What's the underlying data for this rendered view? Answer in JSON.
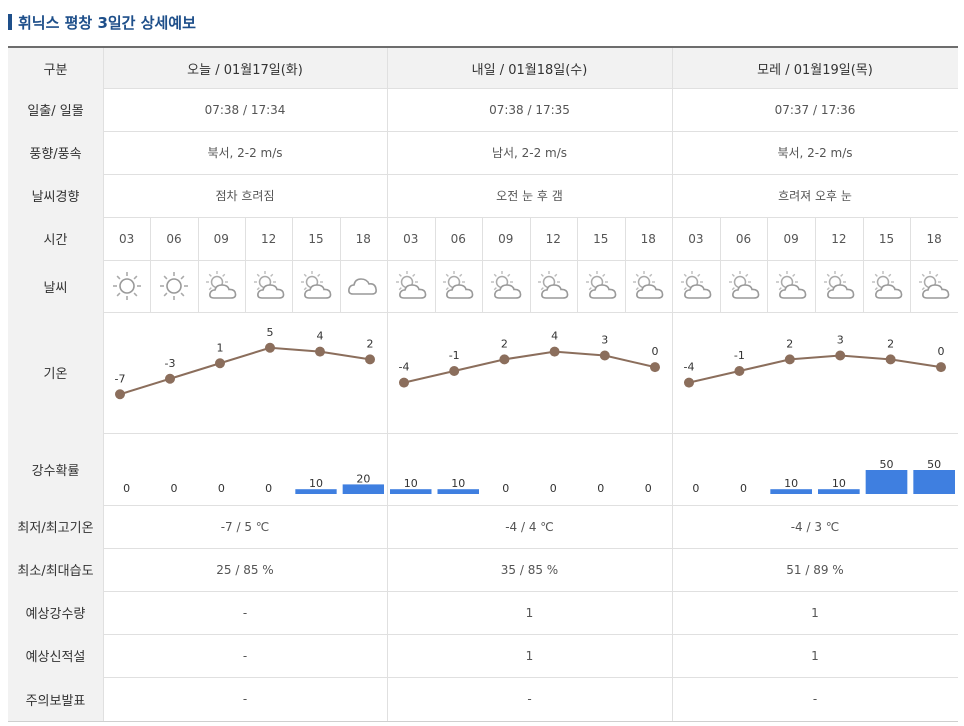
{
  "title": "휘닉스 평창 3일간 상세예보",
  "header": {
    "label": "구분",
    "days": [
      "오늘 / 01월17일(화)",
      "내일 / 01월18일(수)",
      "모레 / 01월19일(목)"
    ]
  },
  "rows": {
    "sun": {
      "label": "일출/ 일몰",
      "values": [
        "07:38 / 17:34",
        "07:38 / 17:35",
        "07:37 / 17:36"
      ]
    },
    "wind": {
      "label": "풍향/풍속",
      "values": [
        "북서, 2-2 m/s",
        "남서, 2-2 m/s",
        "북서, 2-2 m/s"
      ]
    },
    "trend": {
      "label": "날씨경향",
      "values": [
        "점차 흐려짐",
        "오전 눈 후 갬",
        "흐려져 오후 눈"
      ]
    },
    "time": {
      "label": "시간"
    },
    "weather": {
      "label": "날씨"
    },
    "temp": {
      "label": "기온"
    },
    "precip": {
      "label": "강수확률"
    },
    "minmax": {
      "label": "최저/최고기온",
      "values": [
        "-7 / 5 ℃",
        "-4 / 4 ℃",
        "-4 / 3 ℃"
      ]
    },
    "humidity": {
      "label": "최소/최대습도",
      "values": [
        "25 / 85 %",
        "35 / 85 %",
        "51 / 89 %"
      ]
    },
    "rain": {
      "label": "예상강수량",
      "values": [
        "-",
        "1",
        "1"
      ]
    },
    "snow": {
      "label": "예상신적설",
      "values": [
        "-",
        "1",
        "1"
      ]
    },
    "warning": {
      "label": "주의보발표",
      "values": [
        "-",
        "-",
        "-"
      ]
    }
  },
  "hours": [
    "03",
    "06",
    "09",
    "12",
    "15",
    "18",
    "03",
    "06",
    "09",
    "12",
    "15",
    "18",
    "03",
    "06",
    "09",
    "12",
    "15",
    "18"
  ],
  "icons": [
    "sun-icon",
    "sun-icon",
    "sun-cloud-icon",
    "sun-cloud-icon",
    "sun-cloud-icon",
    "cloud-icon",
    "sun-cloud-icon",
    "sun-cloud-icon",
    "sun-cloud-icon",
    "sun-cloud-icon",
    "sun-cloud-icon",
    "sun-cloud-icon",
    "sun-cloud-icon",
    "sun-cloud-icon",
    "sun-cloud-icon",
    "sun-cloud-icon",
    "sun-cloud-icon",
    "sun-cloud-icon"
  ],
  "colors": {
    "line": "#8b6e5c",
    "bar": "#3f7fe0",
    "title": "#1e4f8a"
  },
  "chart_data": [
    {
      "type": "line",
      "name": "기온",
      "days": [
        {
          "x": [
            "03",
            "06",
            "09",
            "12",
            "15",
            "18"
          ],
          "values": [
            -7,
            -3,
            1,
            5,
            4,
            2
          ]
        },
        {
          "x": [
            "03",
            "06",
            "09",
            "12",
            "15",
            "18"
          ],
          "values": [
            -4,
            -1,
            2,
            4,
            3,
            0
          ]
        },
        {
          "x": [
            "03",
            "06",
            "09",
            "12",
            "15",
            "18"
          ],
          "values": [
            -4,
            -1,
            2,
            3,
            2,
            0
          ]
        }
      ]
    },
    {
      "type": "bar",
      "name": "강수확률",
      "days": [
        {
          "x": [
            "03",
            "06",
            "09",
            "12",
            "15",
            "18"
          ],
          "values": [
            0,
            0,
            0,
            0,
            10,
            20
          ]
        },
        {
          "x": [
            "03",
            "06",
            "09",
            "12",
            "15",
            "18"
          ],
          "values": [
            10,
            10,
            0,
            0,
            0,
            0
          ]
        },
        {
          "x": [
            "03",
            "06",
            "09",
            "12",
            "15",
            "18"
          ],
          "values": [
            0,
            0,
            10,
            10,
            50,
            50
          ]
        }
      ]
    }
  ]
}
